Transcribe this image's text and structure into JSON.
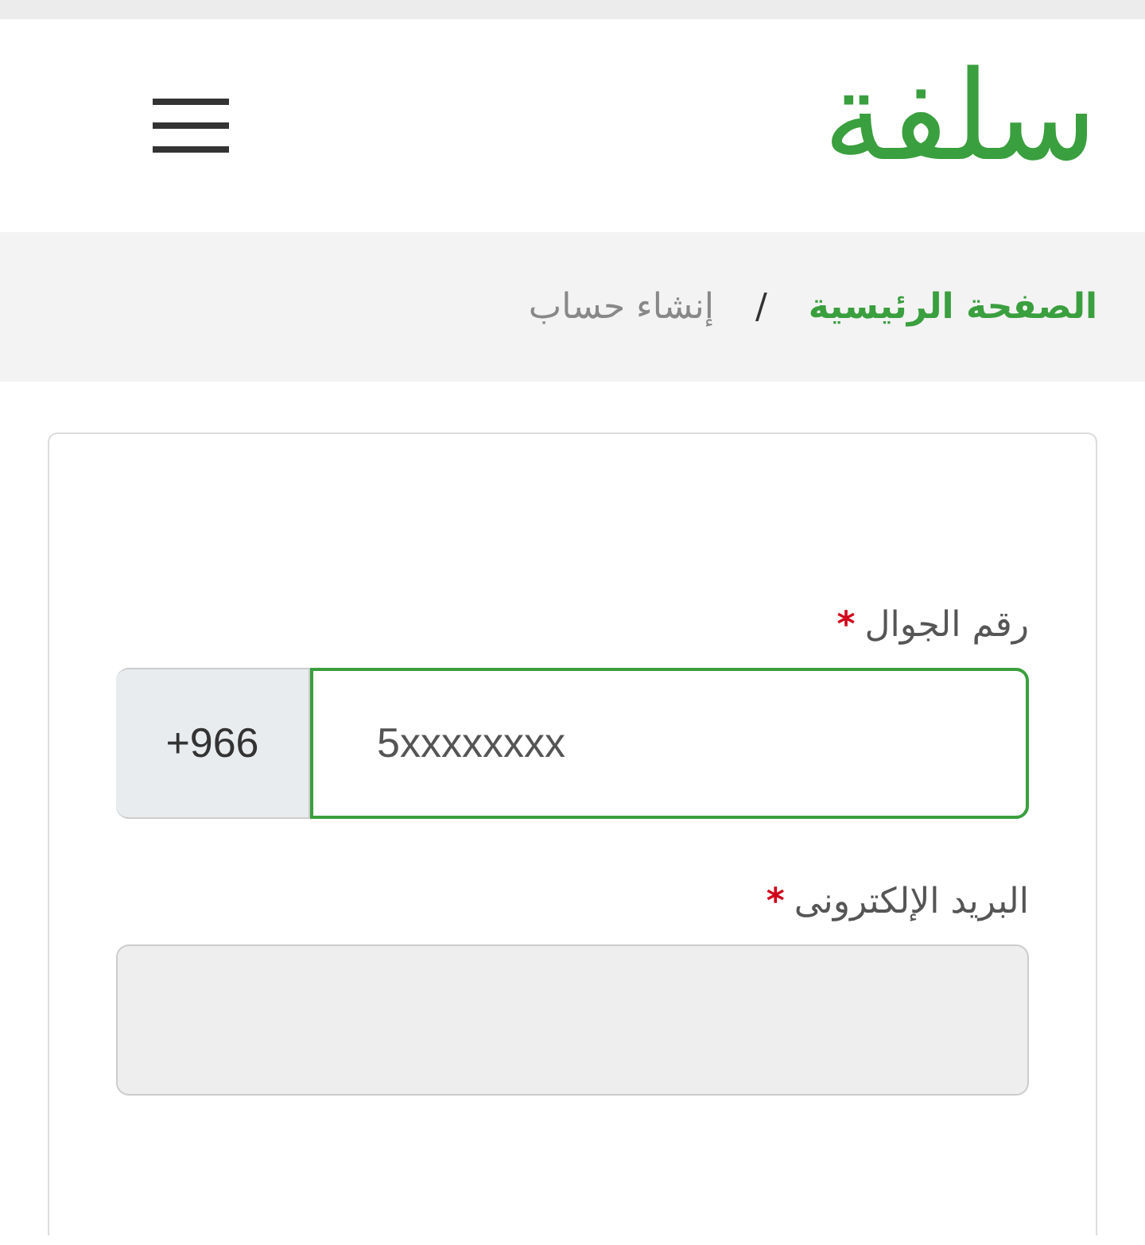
{
  "header": {
    "logo": "سلفة"
  },
  "breadcrumb": [
    {
      "label": "الصفحة الرئيسية",
      "kind": "link"
    },
    {
      "label": "/",
      "kind": "separator"
    },
    {
      "label": "إنشاء حساب",
      "kind": "current"
    }
  ],
  "form": {
    "fields": [
      {
        "label": "رقم الجوال",
        "required_mark": "*",
        "kind": "phone",
        "prefix": "+966",
        "placeholder": "5xxxxxxxx",
        "focused": true,
        "disabled": false
      },
      {
        "label": "البريد الإلكترونى",
        "required_mark": "*",
        "kind": "text",
        "focused": false,
        "disabled": true
      }
    ]
  }
}
